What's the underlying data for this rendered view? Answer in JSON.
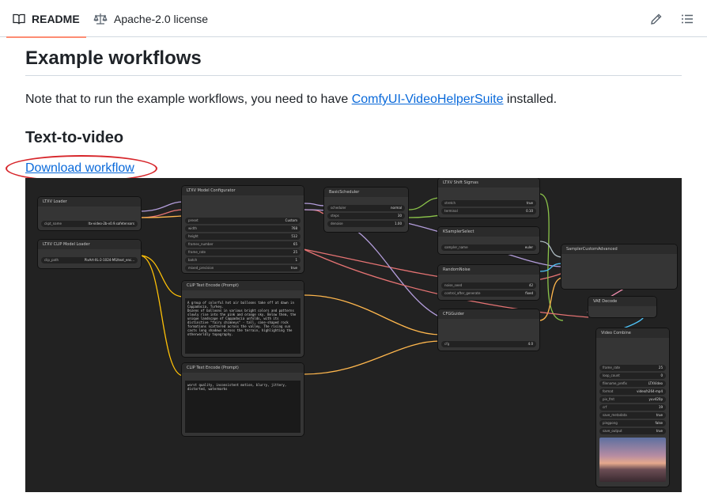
{
  "tabs": {
    "readme": "README",
    "license": "Apache-2.0 license"
  },
  "article": {
    "heading": "Example workflows",
    "intro_before": "Note that to run the example workflows, you need to have ",
    "intro_link": "ComfyUI-VideoHelperSuite",
    "intro_after": " installed.",
    "subheading": "Text-to-video",
    "download_link": "Download workflow"
  },
  "workflow": {
    "ltxv_loader": {
      "title": "LTXV Loader",
      "ckpt_label": "ckpt_name",
      "ckpt_value": "ltx-video-2b-v0.9.safetensors"
    },
    "clip_loader": {
      "title": "LTXV CLIP Model Loader",
      "clip_label": "clip_path",
      "clip_value": "PixArt-XL-2-1024-MS/text_enc..."
    },
    "configurator": {
      "title": "LTXV Model Configurator",
      "preset": [
        "preset",
        "Custom"
      ],
      "width": [
        "width",
        "768"
      ],
      "height": [
        "height",
        "512"
      ],
      "frames": [
        "frames_number",
        "65"
      ],
      "rate": [
        "frame_rate",
        "25"
      ],
      "batch": [
        "batch",
        "1"
      ],
      "mixed": [
        "mixed_precision",
        "true"
      ]
    },
    "scheduler": {
      "title": "BasicScheduler",
      "scheduler": [
        "scheduler",
        "normal"
      ],
      "steps": [
        "steps",
        "30"
      ],
      "denoise": [
        "denoise",
        "1.00"
      ]
    },
    "shift": {
      "title": "LTXV Shift Sigmas",
      "stretch": [
        "stretch",
        "true"
      ],
      "terminal": [
        "terminal",
        "0.10"
      ]
    },
    "sampler_select": {
      "title": "KSamplerSelect",
      "sampler": [
        "sampler_name",
        "euler"
      ]
    },
    "noise": {
      "title": "RandomNoise",
      "seed": [
        "noise_seed",
        "42"
      ],
      "control": [
        "control_after_generate",
        "fixed"
      ]
    },
    "cfg": {
      "title": "CFGGuider",
      "cfg": [
        "cfg",
        "4.0"
      ]
    },
    "sampler_adv": {
      "title": "SamplerCustomAdvanced"
    },
    "vae": {
      "title": "VAE Decode"
    },
    "clip_pos": {
      "title": "CLIP Text Encode (Prompt)",
      "text": "A group of colorful hot air balloons take off at dawn in Cappadocia, Turkey.\nDozens of balloons in various bright colors and patterns slowly rise into the pink and orange sky. Below them, the unique landscape of Cappadocia unfolds, with its distinctive \"fairy chimneys\" - tall, cone-shaped rock formations scattered across the valley. The rising sun casts long shadows across the terrain, highlighting the otherworldly topography."
    },
    "clip_neg": {
      "title": "CLIP Text Encode (Prompt)",
      "text": "worst quality, inconsistent motion, blurry, jittery, distorted, watermarks"
    },
    "combine": {
      "title": "Video Combine",
      "rate": [
        "frame_rate",
        "25"
      ],
      "loop": [
        "loop_count",
        "0"
      ],
      "prefix": [
        "filename_prefix",
        "LTXVideo"
      ],
      "format": [
        "format",
        "video/h264-mp4"
      ],
      "pix": [
        "pix_fmt",
        "yuv420p"
      ],
      "crf": [
        "crf",
        "19"
      ],
      "meta": [
        "save_metadata",
        "true"
      ],
      "ping": [
        "pingpong",
        "false"
      ],
      "save": [
        "save_output",
        "true"
      ]
    }
  },
  "colors": {
    "link": "#0969da",
    "annotation": "#d7262b",
    "tab_underline": "#fd8c73"
  }
}
